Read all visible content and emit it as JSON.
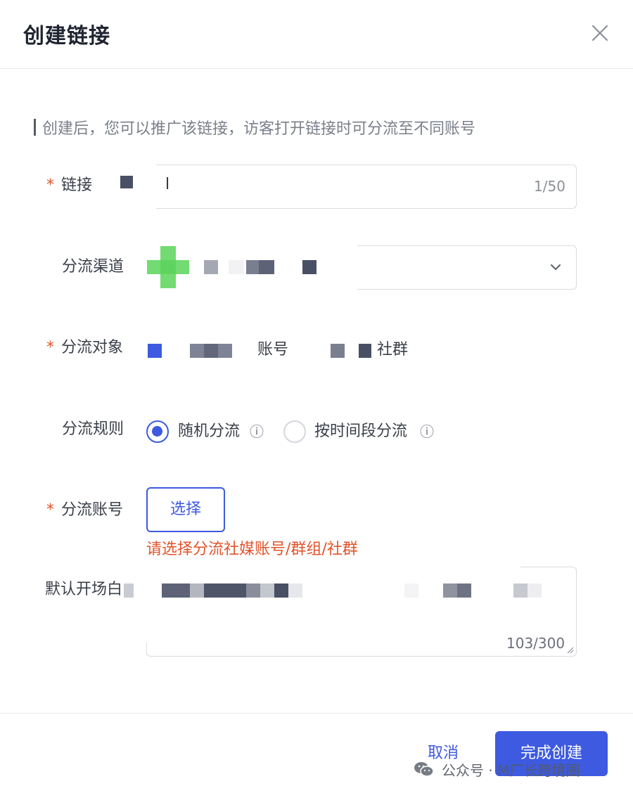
{
  "dialog": {
    "title": "创建链接",
    "close_icon": "close-icon"
  },
  "hint": "创建后，您可以推广该链接，访客打开链接时可分流至不同账号",
  "form": {
    "link": {
      "required_mark": "*",
      "label": "链接",
      "value": "l",
      "counter": "1/50"
    },
    "channel": {
      "label": "分流渠道",
      "icon": "chevron-down-icon"
    },
    "target": {
      "required_mark": "*",
      "label": "分流对象",
      "option_account": "账号",
      "option_community": "社群"
    },
    "rule": {
      "label": "分流规则",
      "options": [
        {
          "label": "随机分流",
          "selected": true
        },
        {
          "label": "按时间段分流",
          "selected": false
        }
      ],
      "info_glyph": "ⓘ"
    },
    "accounts": {
      "required_mark": "*",
      "label": "分流账号",
      "button": "选择",
      "error": "请选择分流社媒账号/群组/社群"
    },
    "greeting": {
      "label": "默认开场白",
      "counter": "103/300"
    }
  },
  "footer": {
    "cancel": "取消",
    "submit": "完成创建"
  },
  "watermark": "公众号 · M厂长跨境圈",
  "colors": {
    "accent": "#3d5ae0",
    "error": "#e2542b",
    "wechat_green": "#6cd96c"
  }
}
